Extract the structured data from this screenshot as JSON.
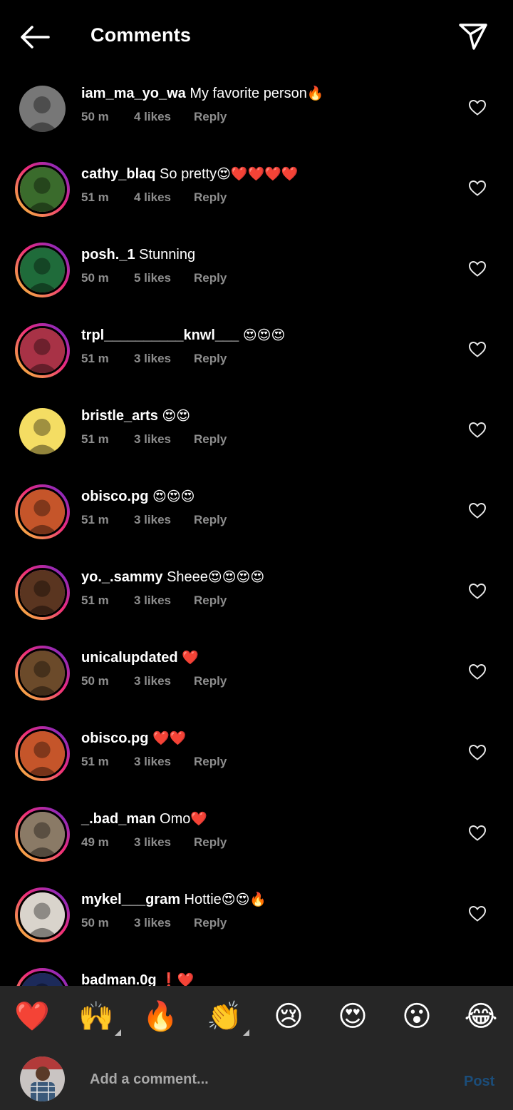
{
  "header": {
    "title": "Comments",
    "back_icon": "arrow-left-icon",
    "share_icon": "paper-plane-icon"
  },
  "comments": [
    {
      "username": "iam_ma_yo_wa",
      "text": "My favorite person",
      "emoji": "🔥",
      "time": "50 m",
      "likes": "4 likes",
      "reply": "Reply",
      "ring": false,
      "avatar_color": "#777777"
    },
    {
      "username": "cathy_blaq",
      "text": "So pretty",
      "emoji": "😍❤️❤️❤️❤️",
      "time": "51 m",
      "likes": "4 likes",
      "reply": "Reply",
      "ring": true,
      "avatar_color": "#3a6b2c"
    },
    {
      "username": "posh._1",
      "text": "Stunning",
      "emoji": "",
      "time": "50 m",
      "likes": "5 likes",
      "reply": "Reply",
      "ring": true,
      "avatar_color": "#1f6b3a"
    },
    {
      "username": "trpl__________knwl___",
      "text": "",
      "emoji": "😍😍😍",
      "time": "51 m",
      "likes": "3 likes",
      "reply": "Reply",
      "ring": true,
      "avatar_color": "#a83246"
    },
    {
      "username": "bristle_arts",
      "text": "",
      "emoji": "😍😍",
      "time": "51 m",
      "likes": "3 likes",
      "reply": "Reply",
      "ring": false,
      "avatar_color": "#f4dd63"
    },
    {
      "username": "obisco.pg",
      "text": "",
      "emoji": "😍😍😍",
      "time": "51 m",
      "likes": "3 likes",
      "reply": "Reply",
      "ring": true,
      "avatar_color": "#c5552a"
    },
    {
      "username": "yo._.sammy",
      "text": "Sheee",
      "emoji": "😍😍😍😍",
      "time": "51 m",
      "likes": "3 likes",
      "reply": "Reply",
      "ring": true,
      "avatar_color": "#5a3520"
    },
    {
      "username": "unicalupdated",
      "text": "",
      "emoji": "❤️",
      "time": "50 m",
      "likes": "3 likes",
      "reply": "Reply",
      "ring": true,
      "avatar_color": "#6b4a2a"
    },
    {
      "username": "obisco.pg",
      "text": "",
      "emoji": "❤️❤️",
      "time": "51 m",
      "likes": "3 likes",
      "reply": "Reply",
      "ring": true,
      "avatar_color": "#c5552a"
    },
    {
      "username": "_.bad_man",
      "text": "Omo",
      "emoji": "❤️",
      "time": "49 m",
      "likes": "3 likes",
      "reply": "Reply",
      "ring": true,
      "avatar_color": "#8a7a66"
    },
    {
      "username": "mykel___gram",
      "text": "Hottie",
      "emoji": "😍😍🔥",
      "time": "50 m",
      "likes": "3 likes",
      "reply": "Reply",
      "ring": true,
      "avatar_color": "#d9d4cc"
    },
    {
      "username": "badman.0g",
      "text": "",
      "emoji": "❗❤️",
      "time": "",
      "likes": "",
      "reply": "",
      "ring": true,
      "avatar_color": "#1c2a5a"
    }
  ],
  "emoji_bar": [
    {
      "emoji": "❤️",
      "has_variants": false
    },
    {
      "emoji": "🙌",
      "has_variants": true
    },
    {
      "emoji": "🔥",
      "has_variants": false
    },
    {
      "emoji": "👏",
      "has_variants": true
    },
    {
      "emoji": "😢",
      "has_variants": false
    },
    {
      "emoji": "😍",
      "has_variants": false
    },
    {
      "emoji": "😮",
      "has_variants": false
    },
    {
      "emoji": "😂",
      "has_variants": false
    }
  ],
  "composer": {
    "placeholder": "Add a comment...",
    "post_label": "Post"
  },
  "colors": {
    "background": "#000000",
    "secondary_text": "#8e8e8e",
    "bar_background": "#262626",
    "post_disabled": "#1b4d7a"
  }
}
